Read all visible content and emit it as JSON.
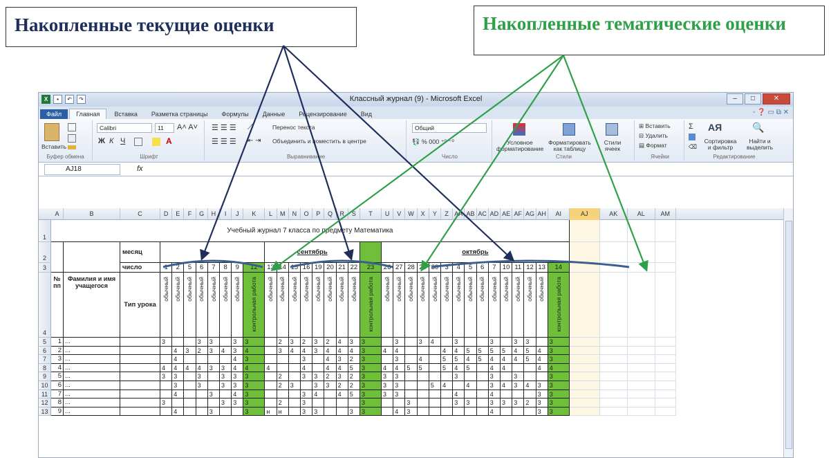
{
  "callouts": {
    "current": "Накопленные текущие оценки",
    "thematic": "Накопленные тематические оценки"
  },
  "colors": {
    "current": "#1f2f5c",
    "thematic": "#2fa048",
    "control_column": "#6fbf3a"
  },
  "window": {
    "title": "Классный журнал (9) - Microsoft Excel"
  },
  "tabs": [
    "Файл",
    "Главная",
    "Вставка",
    "Разметка страницы",
    "Формулы",
    "Данные",
    "Рецензирование",
    "Вид"
  ],
  "ribbon": {
    "paste": "Вставить",
    "clipboard": "Буфер обмена",
    "font_name": "Calibri",
    "font_size": "11",
    "font_group": "Шрифт",
    "wrap_text": "Перенос текста",
    "merge_center": "Объединить и поместить в центре",
    "alignment_group": "Выравнивание",
    "number_format": "Общий",
    "number_group": "Число",
    "conditional": "Условное форматирование",
    "as_table": "Форматировать как таблицу",
    "cell_styles": "Стили ячеек",
    "styles_group": "Стили",
    "insert": "Вставить",
    "delete": "Удалить",
    "format": "Формат",
    "cells_group": "Ячейки",
    "sort_filter": "Сортировка и фильтр",
    "find_select": "Найти и выделить",
    "editing_group": "Редактирование"
  },
  "formula_bar": {
    "name_box": "AJ18",
    "fx": "fx"
  },
  "col_headers": [
    "A",
    "B",
    "C",
    "D",
    "E",
    "F",
    "G",
    "H",
    "I",
    "J",
    "K",
    "L",
    "M",
    "N",
    "O",
    "P",
    "Q",
    "R",
    "S",
    "T",
    "U",
    "V",
    "W",
    "X",
    "Y",
    "Z",
    "AA",
    "AB",
    "AC",
    "AD",
    "AE",
    "AF",
    "AG",
    "AH",
    "AI",
    "AJ",
    "AK",
    "AL",
    "AM"
  ],
  "sheet": {
    "title": "Учебный журнал 7 класса по предмету Математика",
    "label_month": "месяц",
    "label_day": "число",
    "label_num": "№ пп",
    "label_name": "Фамилия и имя учащегося",
    "label_lesson": "Тип урока",
    "month_sept": "сентябрь",
    "month_oct": "октябрь",
    "lesson_regular": "обычный",
    "lesson_control": "контрольная работа",
    "days": [
      "1",
      "2",
      "5",
      "6",
      "7",
      "8",
      "9",
      "12",
      "13",
      "14",
      "15",
      "16",
      "19",
      "20",
      "21",
      "22",
      "23",
      "26",
      "27",
      "28",
      "29",
      "30",
      "3",
      "4",
      "5",
      "6",
      "7",
      "10",
      "11",
      "12",
      "13",
      "14"
    ],
    "control_indices": [
      7,
      16,
      31
    ],
    "students": [
      {
        "n": "1",
        "name": "...",
        "g": [
          "3",
          "",
          "",
          "3",
          "3",
          "",
          "3",
          "3",
          "",
          "2",
          "3",
          "2",
          "3",
          "2",
          "4",
          "3",
          "3",
          "",
          "3",
          "",
          "3",
          "4",
          "",
          "3",
          "",
          "",
          "3",
          "",
          "3",
          "3",
          "",
          "3"
        ]
      },
      {
        "n": "2",
        "name": "...",
        "g": [
          "",
          "4",
          "3",
          "2",
          "3",
          "4",
          "3",
          "4",
          "",
          "3",
          "4",
          "4",
          "3",
          "4",
          "4",
          "4",
          "3",
          "4",
          "4",
          "",
          "",
          "",
          "4",
          "4",
          "5",
          "5",
          "5",
          "5",
          "4",
          "5",
          "4",
          "3"
        ]
      },
      {
        "n": "3",
        "name": "...",
        "g": [
          "",
          "4",
          "",
          "",
          "",
          "",
          "4",
          "3",
          "",
          "",
          "",
          "3",
          "",
          "4",
          "3",
          "2",
          "3",
          "",
          "3",
          "",
          "4",
          "",
          "5",
          "5",
          "4",
          "5",
          "4",
          "4",
          "4",
          "5",
          "4",
          "3"
        ]
      },
      {
        "n": "4",
        "name": "...",
        "g": [
          "4",
          "4",
          "4",
          "4",
          "3",
          "3",
          "4",
          "4",
          "4",
          "",
          "",
          "4",
          "",
          "4",
          "4",
          "5",
          "3",
          "4",
          "4",
          "5",
          "5",
          "",
          "5",
          "4",
          "5",
          "",
          "4",
          "4",
          "",
          "",
          "4",
          "4"
        ]
      },
      {
        "n": "5",
        "name": "...",
        "g": [
          "3",
          "3",
          "",
          "3",
          "",
          "3",
          "3",
          "3",
          "",
          "2",
          "",
          "3",
          "3",
          "2",
          "3",
          "2",
          "3",
          "3",
          "3",
          "",
          "",
          "",
          "",
          "3",
          "",
          "",
          "3",
          "",
          "3",
          "",
          "",
          "3"
        ]
      },
      {
        "n": "6",
        "name": "...",
        "g": [
          "",
          "3",
          "",
          "3",
          "",
          "3",
          "3",
          "3",
          "",
          "2",
          "3",
          "",
          "3",
          "3",
          "2",
          "2",
          "3",
          "3",
          "3",
          "",
          "",
          "5",
          "4",
          "",
          "4",
          "",
          "3",
          "4",
          "3",
          "4",
          "3",
          "3"
        ]
      },
      {
        "n": "7",
        "name": "...",
        "g": [
          "",
          "4",
          "",
          "",
          "3",
          "",
          "4",
          "3",
          "",
          "",
          "",
          "3",
          "4",
          "",
          "4",
          "5",
          "3",
          "3",
          "3",
          "",
          "",
          "",
          "",
          "4",
          "",
          "",
          "4",
          "",
          "",
          "",
          "3",
          "3"
        ]
      },
      {
        "n": "8",
        "name": "...",
        "g": [
          "3",
          "",
          "",
          "",
          "",
          "3",
          "3",
          "3",
          "",
          "2",
          "",
          "3",
          "",
          "",
          "",
          "",
          "3",
          "",
          "",
          "3",
          "",
          "",
          "",
          "3",
          "3",
          "",
          "3",
          "3",
          "3",
          "2",
          "3",
          "3"
        ]
      },
      {
        "n": "9",
        "name": "...",
        "g": [
          "",
          "4",
          "",
          "",
          "3",
          "",
          "",
          "3",
          "н",
          "н",
          "",
          "3",
          "3",
          "",
          "",
          "3",
          "3",
          "",
          "4",
          "3",
          "",
          "",
          "",
          "",
          "",
          "",
          "4",
          "",
          "",
          "",
          "3",
          "3"
        ]
      }
    ]
  }
}
